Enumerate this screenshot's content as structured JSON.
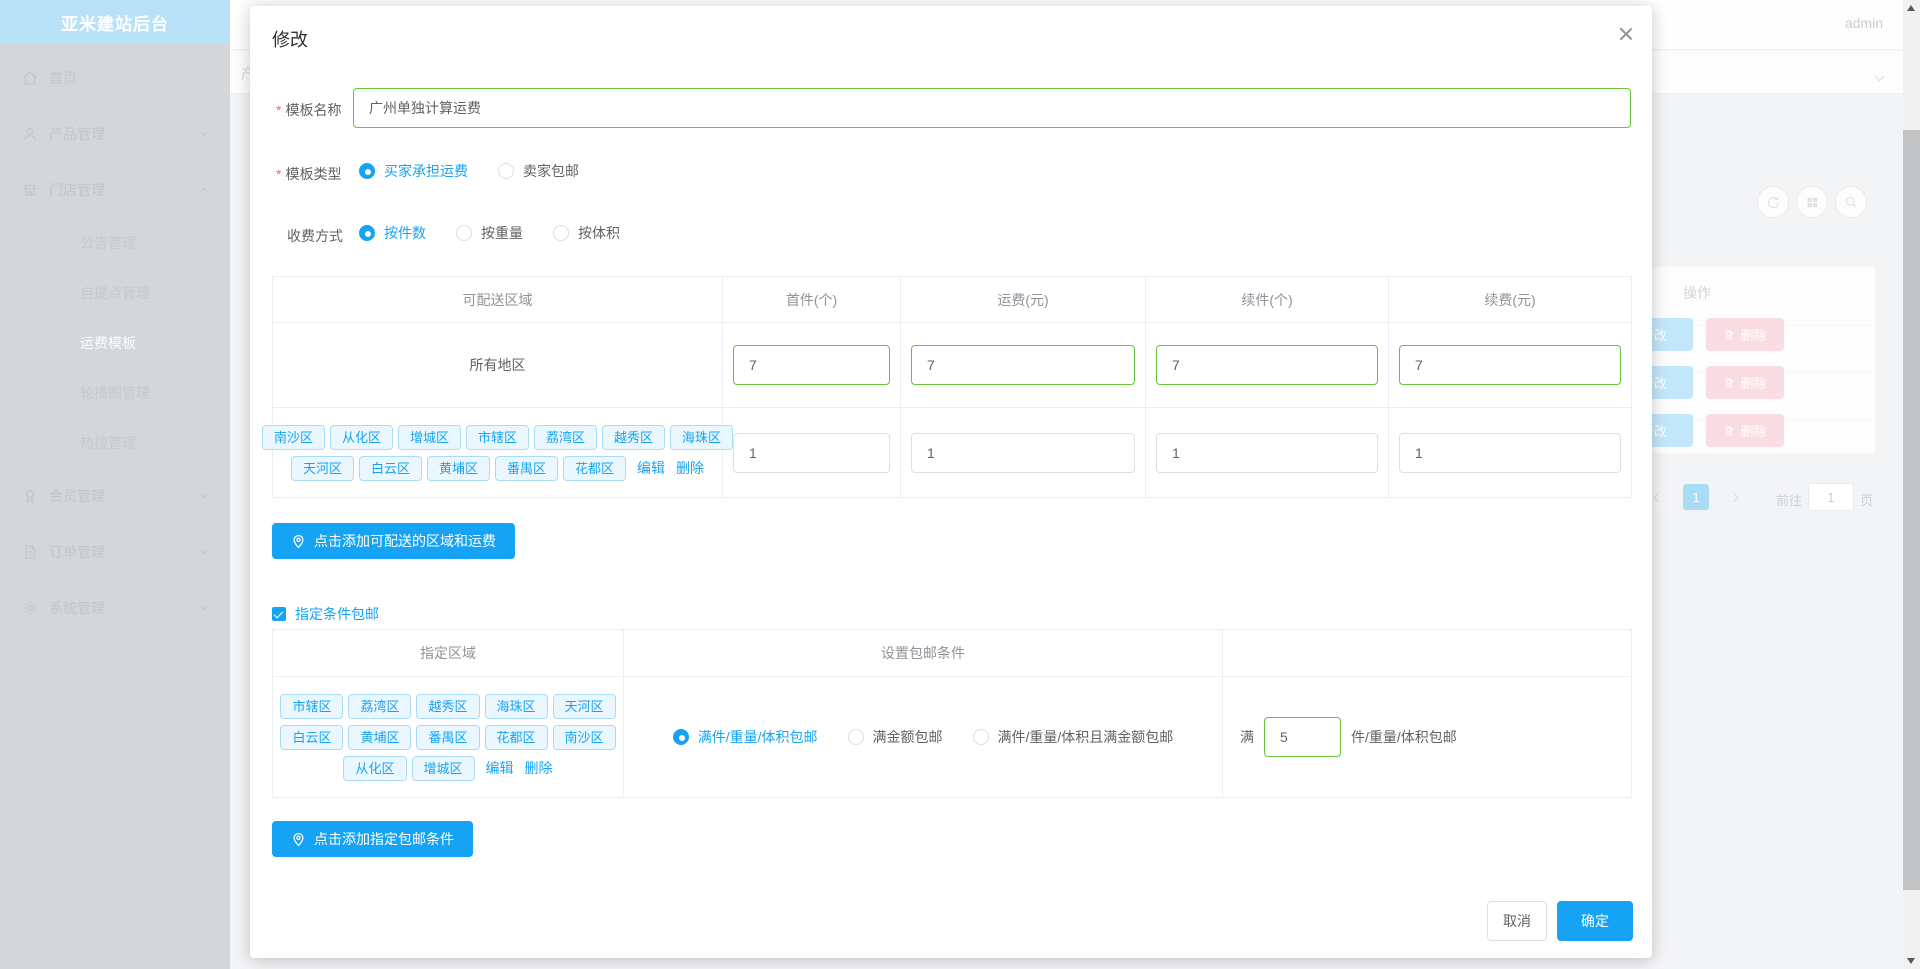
{
  "app_title": "亚米建站后台",
  "topbar": {
    "username": "admin"
  },
  "sidebar": {
    "items": [
      {
        "label": "首页"
      },
      {
        "label": "产品管理"
      },
      {
        "label": "门店管理"
      },
      {
        "label": "会员管理"
      },
      {
        "label": "订单管理"
      },
      {
        "label": "系统管理"
      }
    ],
    "store_submenu": [
      "公告管理",
      "自提点管理",
      "运费模板",
      "轮播图管理",
      "热搜管理"
    ],
    "active_item": "运费模板"
  },
  "background": {
    "partial_text": "产",
    "operation_header": "操作",
    "edit_button": "修改",
    "delete_button": "删除",
    "pagination": {
      "page": "1",
      "goto": "前往",
      "goto_value": "1",
      "unit": "页"
    }
  },
  "dialog": {
    "title": "修改",
    "required_mark": "*",
    "name_field": {
      "label": "模板名称",
      "value": "广州单独计算运费"
    },
    "type_field": {
      "label": "模板类型",
      "options": [
        "买家承担运费",
        "卖家包邮"
      ],
      "selected": "买家承担运费"
    },
    "charge_field": {
      "label": "收费方式",
      "options": [
        "按件数",
        "按重量",
        "按体积"
      ],
      "selected": "按件数"
    },
    "region_table": {
      "headers": [
        "可配送区域",
        "首件(个)",
        "运费(元)",
        "续件(个)",
        "续费(元)"
      ],
      "row_all": {
        "region": "所有地区",
        "values": [
          "7",
          "7",
          "7",
          "7"
        ]
      },
      "row_custom": {
        "tags": [
          "南沙区",
          "从化区",
          "增城区",
          "市辖区",
          "荔湾区",
          "越秀区",
          "海珠区",
          "天河区",
          "白云区",
          "黄埔区",
          "番禺区",
          "花都区"
        ],
        "edit": "编辑",
        "delete": "删除",
        "values": [
          "1",
          "1",
          "1",
          "1"
        ]
      }
    },
    "add_region_button": "点击添加可配送的区域和运费",
    "free_condition_checkbox": "指定条件包邮",
    "condition_table": {
      "headers": [
        "指定区域",
        "设置包邮条件",
        ""
      ],
      "row": {
        "tags": [
          "市辖区",
          "荔湾区",
          "越秀区",
          "海珠区",
          "天河区",
          "白云区",
          "黄埔区",
          "番禺区",
          "花都区",
          "南沙区",
          "从化区",
          "增城区"
        ],
        "edit": "编辑",
        "delete": "删除",
        "options": [
          "满件/重量/体积包邮",
          "满金额包邮",
          "满件/重量/体积且满金额包邮"
        ],
        "selected": "满件/重量/体积包邮",
        "prefix": "满",
        "value": "5",
        "suffix": "件/重量/体积包邮"
      }
    },
    "add_condition_button": "点击添加指定包邮条件",
    "cancel_button": "取消",
    "confirm_button": "确定"
  },
  "colors": {
    "primary": "#17a3f3",
    "success_border": "#67c23a",
    "required": "#f56c6c"
  }
}
